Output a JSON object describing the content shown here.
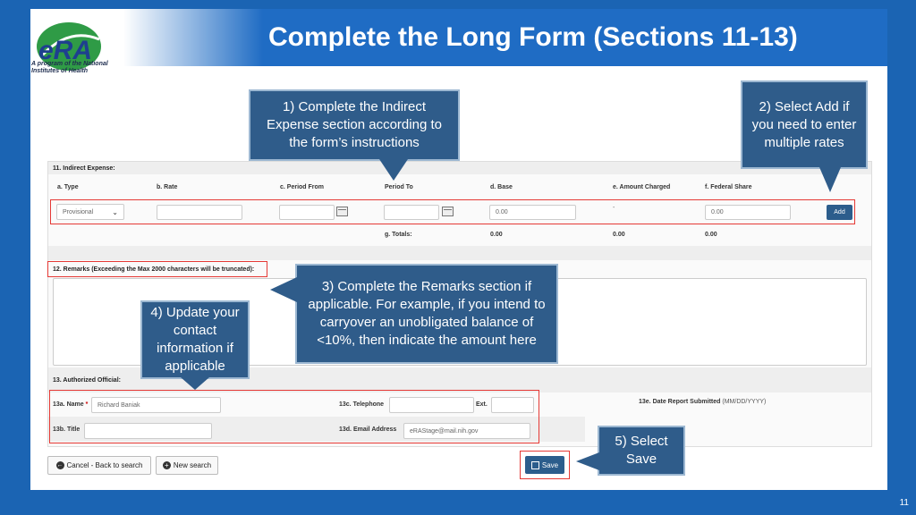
{
  "header": {
    "title": "Complete the Long Form (Sections 11-13)",
    "logo_text": "eRA",
    "logo_tagline": "A program of the National Institutes of Health"
  },
  "slide_number": "11",
  "indirect_expense": {
    "section_label": "11. Indirect Expense:",
    "columns": [
      "a. Type",
      "b. Rate",
      "c. Period From",
      "Period To",
      "d. Base",
      "e. Amount Charged",
      "f. Federal Share"
    ],
    "type_value": "Provisional",
    "base_value": "0.00",
    "amount_charged_value": "-",
    "federal_share_value": "0.00",
    "add_label": "Add",
    "totals_label": "g. Totals:",
    "totals": [
      "0.00",
      "0.00",
      "0.00"
    ]
  },
  "remarks": {
    "section_label": "12. Remarks (Exceeding the Max 2000 characters will be truncated):"
  },
  "authorized_official": {
    "section_label": "13. Authorized Official:",
    "name_label": "13a. Name",
    "name_value": "Richard Baniak",
    "telephone_label": "13c. Telephone",
    "ext_label": "Ext.",
    "title_label": "13b. Title",
    "email_label": "13d. Email Address",
    "email_value": "eRAStage@mail.nih.gov",
    "date_label": "13e. Date Report Submitted",
    "date_format": "(MM/DD/YYYY)"
  },
  "buttons": {
    "cancel": "Cancel - Back to search",
    "new_search": "New search",
    "save": "Save"
  },
  "callouts": {
    "c1": "1) Complete the Indirect Expense section according to the form’s instructions",
    "c2": "2) Select Add if you need to enter multiple rates",
    "c3": "3) Complete the Remarks section if applicable.  For example, if you intend to carryover an unobligated balance of <10%, then indicate the amount here",
    "c4": "4) Update your contact information if applicable",
    "c5": "5) Select Save"
  },
  "colors": {
    "title_bar": "#1f6cc4",
    "callout": "#2f5c8a",
    "highlight": "#e53935",
    "button_blue": "#2c5d8c"
  }
}
